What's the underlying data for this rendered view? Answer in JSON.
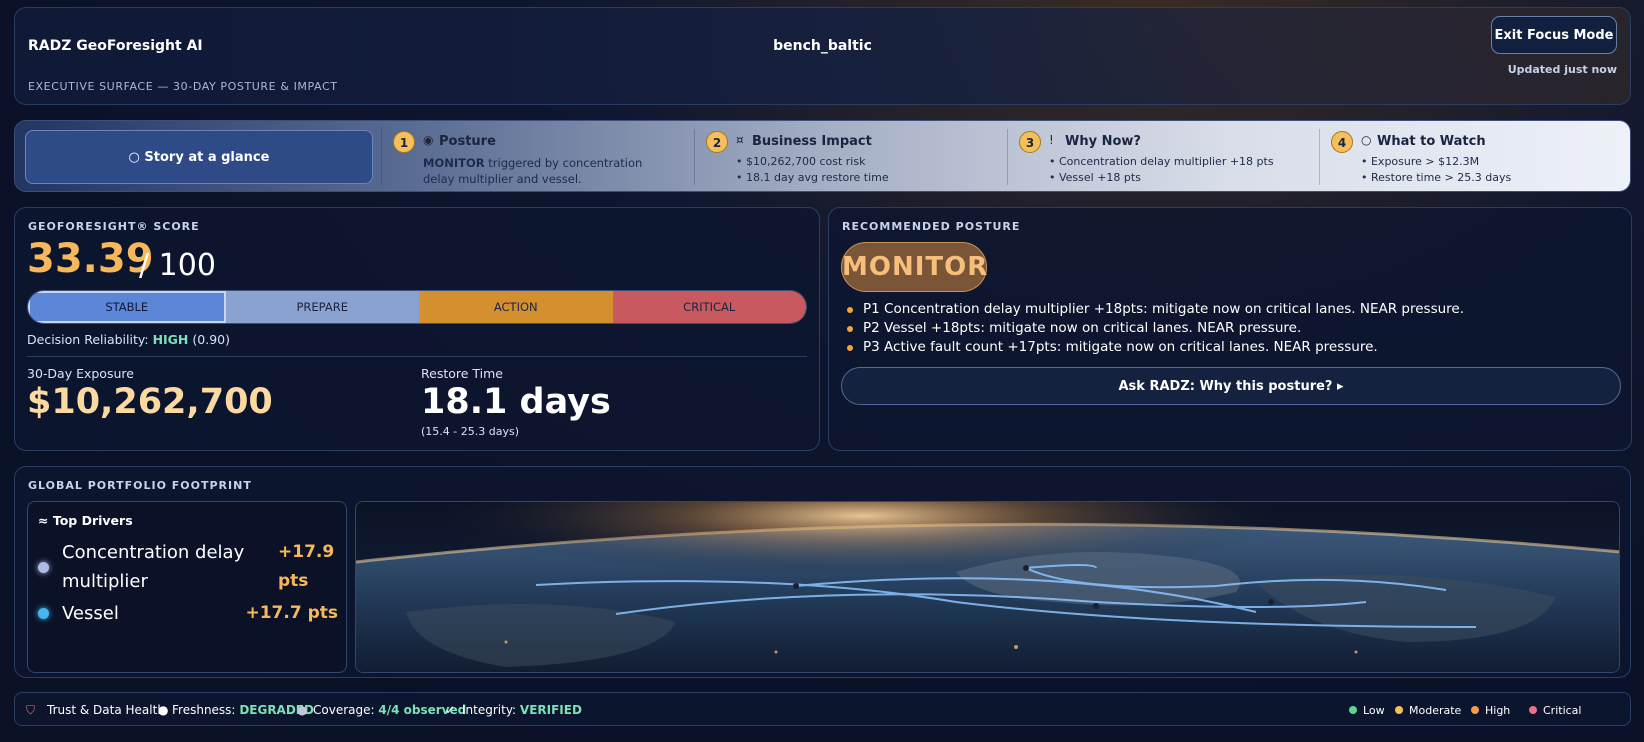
{
  "header": {
    "brand": "RADZ GeoForesight AI",
    "subtitle": "EXECUTIVE SURFACE — 30-DAY POSTURE & IMPACT",
    "workspace": "bench_baltic",
    "exit_label": "Exit Focus Mode",
    "updated": "Updated just now"
  },
  "story": {
    "glance_label": "○ Story at a glance",
    "steps": [
      {
        "num": "1",
        "icon": "◉",
        "title": "Posture",
        "desc_strong": "MONITOR",
        "desc_rest": " triggered by concentration delay multiplier and vessel."
      },
      {
        "num": "2",
        "icon": "¤",
        "title": "Business Impact",
        "lines": [
          "• $10,262,700 cost risk",
          "• 18.1 day avg restore time"
        ]
      },
      {
        "num": "3",
        "icon": "!",
        "title": "Why Now?",
        "lines": [
          "• Concentration delay multiplier +18 pts",
          "• Vessel +18 pts"
        ]
      },
      {
        "num": "4",
        "icon": "○",
        "title": "What to Watch",
        "lines": [
          "• Exposure > $12.3M",
          "• Restore time > 25.3 days"
        ]
      }
    ]
  },
  "score": {
    "label": "GEOFORESIGHT® SCORE",
    "value": "33.39",
    "max": "/ 100",
    "scale": [
      "STABLE",
      "PREPARE",
      "ACTION",
      "CRITICAL"
    ],
    "reliability_label": "Decision Reliability:",
    "reliability_level": "HIGH",
    "reliability_value": "(0.90)",
    "exposure_label": "30-Day Exposure",
    "exposure_value": "$10,262,700",
    "restore_label": "Restore Time",
    "restore_value": "18.1 days",
    "restore_range": "(15.4 - 25.3 days)"
  },
  "posture": {
    "label": "RECOMMENDED POSTURE",
    "badge": "MONITOR",
    "items": [
      "P1 Concentration delay multiplier +18pts: mitigate now on critical lanes. NEAR pressure.",
      "P2 Vessel +18pts: mitigate now on critical lanes. NEAR pressure.",
      "P3 Active fault count +17pts: mitigate now on critical lanes. NEAR pressure."
    ],
    "ask_label": "Ask RADZ: Why this posture? ▸"
  },
  "footprint": {
    "label": "GLOBAL PORTFOLIO FOOTPRINT",
    "drivers_title": "≈ Top Drivers",
    "drivers": [
      {
        "name": "Concentration delay multiplier",
        "value": "+17.9 pts",
        "color": "#aebbe3"
      },
      {
        "name": "Vessel",
        "value": "+17.7 pts",
        "color": "#46b6f0"
      }
    ]
  },
  "footer": {
    "trust_label": "Trust & Data Health",
    "freshness_label": "Freshness:",
    "freshness_value": "DEGRADED",
    "coverage_label": "Coverage:",
    "coverage_value": "4/4 observed",
    "integrity_label": "Integrity:",
    "integrity_value": "VERIFIED",
    "legend": [
      {
        "label": "Low",
        "color": "#5ed39a"
      },
      {
        "label": "Moderate",
        "color": "#f5c05c"
      },
      {
        "label": "High",
        "color": "#f59a4a"
      },
      {
        "label": "Critical",
        "color": "#ee6f8a"
      }
    ]
  },
  "colors": {
    "accent_orange": "#f6b85a",
    "ok_green": "#7fe0b7"
  }
}
